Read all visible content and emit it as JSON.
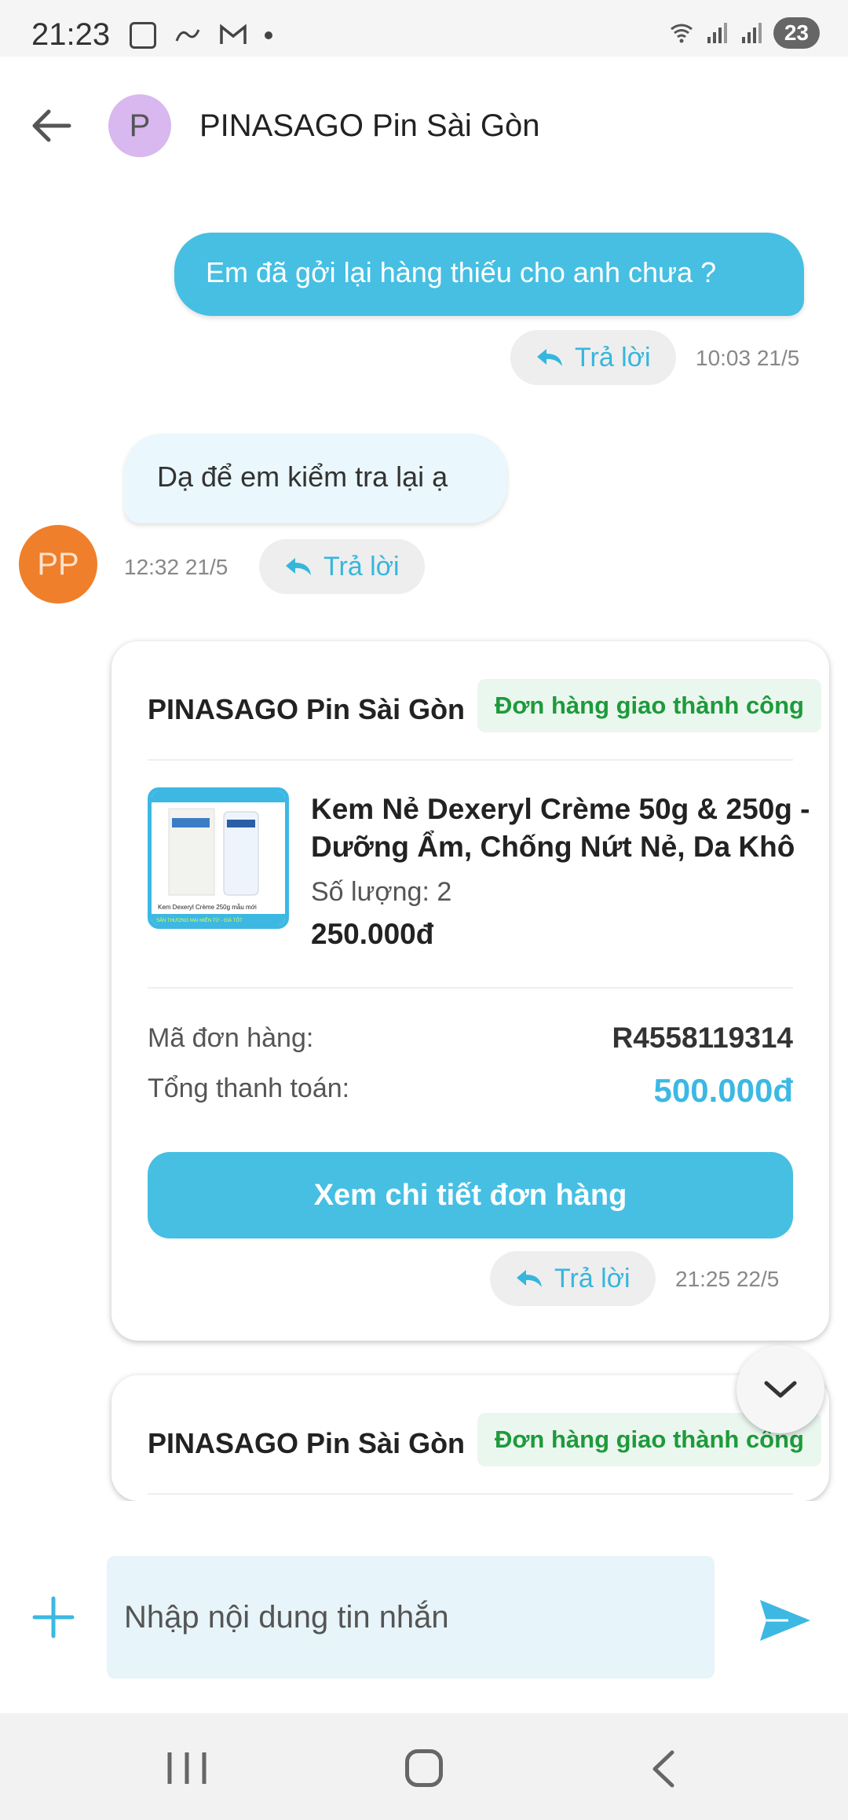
{
  "status_bar": {
    "time": "21:23",
    "battery": "23"
  },
  "header": {
    "avatar_letter": "P",
    "title": "PINASAGO Pin Sài Gòn"
  },
  "messages": {
    "outgoing": {
      "text": "Em đã gởi lại hàng thiếu cho anh chưa  ?",
      "reply_label": "Trả lời",
      "timestamp": "10:03 21/5"
    },
    "incoming": {
      "text": "Dạ để em kiểm tra lại ạ",
      "avatar_initials": "PP",
      "timestamp": "12:32 21/5",
      "reply_label": "Trả lời"
    }
  },
  "order_card": {
    "shop": "PINASAGO Pin Sài Gòn",
    "status": "Đơn hàng giao thành công",
    "product_name": "Kem Nẻ Dexeryl Crème 50g & 250g - Dưỡng Ẩm, Chống Nứt Nẻ, Da Khô",
    "quantity": "Số lượng: 2",
    "price": "250.000đ",
    "order_id_label": "Mã đơn hàng:",
    "order_id": "R4558119314",
    "total_label": "Tổng thanh toán:",
    "total": "500.000đ",
    "detail_button": "Xem chi tiết đơn hàng",
    "reply_label": "Trả lời",
    "timestamp": "21:25 22/5",
    "image_banner_text": "Kem Dexeryl Crème 250g mẫu mới",
    "image_footer_text": "SẢN THƯƠNG MẠI MIỄN TỪ - GIÁ TỐT"
  },
  "order_card_2": {
    "shop": "PINASAGO Pin Sài Gòn",
    "status": "Đơn hàng giao thành công"
  },
  "composer": {
    "placeholder": "Nhập nội dung tin nhắn"
  },
  "colors": {
    "accent": "#46bfe3",
    "success": "#1e9a3c",
    "avatar_orange": "#ef7f2a",
    "avatar_purple": "#d8b8ef"
  },
  "icons": [
    "back-arrow-icon",
    "reply-icon",
    "chevron-down-icon",
    "plus-icon",
    "send-icon"
  ]
}
